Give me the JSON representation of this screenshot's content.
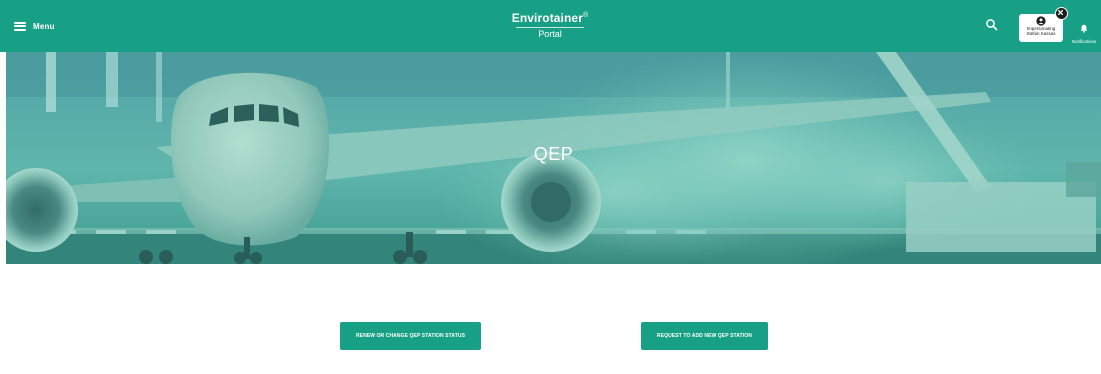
{
  "topbar": {
    "menu_label": "Menu",
    "brand_name": "Envirotainer",
    "brand_mark": "®",
    "brand_sub": "Portal",
    "impersonating_line1": "Impersonating",
    "impersonating_line2": "Stefan Kassas",
    "notifications_label": "Notifications",
    "icons": {
      "menu": "hamburger-icon",
      "search": "search-icon",
      "impersonation": "user-circle-icon",
      "close": "close-icon",
      "notifications": "bell-icon"
    }
  },
  "hero": {
    "title": "QEP"
  },
  "actions": {
    "renew_label": "RENEW OR CHANGE QEP STATION STATUS",
    "request_label": "REQUEST TO ADD NEW QEP STATION"
  },
  "colors": {
    "brand_teal": "#17a085",
    "hero_overlay": "#3fb8a4",
    "white": "#ffffff"
  }
}
